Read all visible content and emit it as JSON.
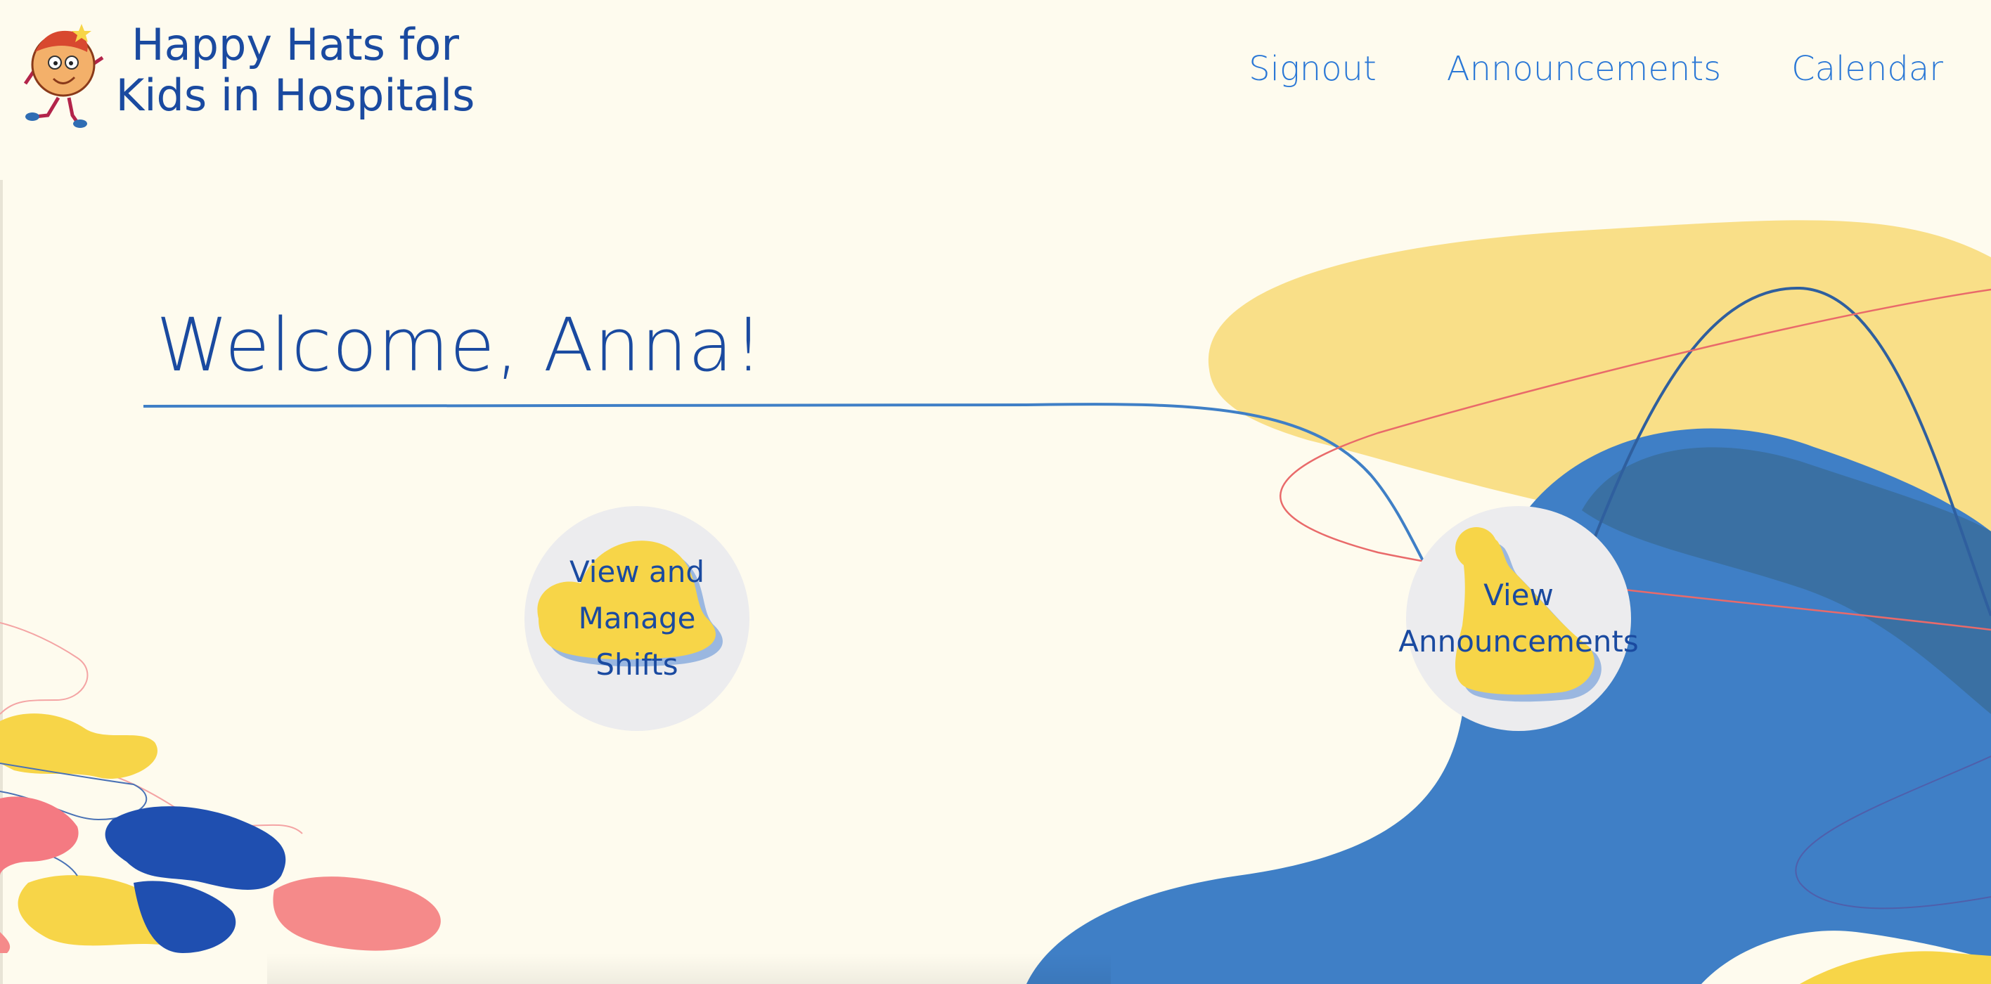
{
  "header": {
    "brand": "Happy Hats for Kids in Hospitals",
    "nav": {
      "signout": "Signout",
      "announcements": "Announcements",
      "calendar": "Calendar"
    }
  },
  "main": {
    "welcome": "Welcome, Anna!",
    "actions": {
      "shifts_label": "View and Manage Shifts",
      "announcements_label": "View Announcements"
    }
  },
  "colors": {
    "background": "#fefbee",
    "primary_text": "#1a4aa0",
    "nav_link": "#2b78d6",
    "accent_yellow": "#f7d548",
    "accent_blue": "#3f7fc6",
    "accent_coral": "#f58a8a"
  },
  "icons": [
    "logo-mascot-icon",
    "hat-icon",
    "beanie-icon"
  ]
}
